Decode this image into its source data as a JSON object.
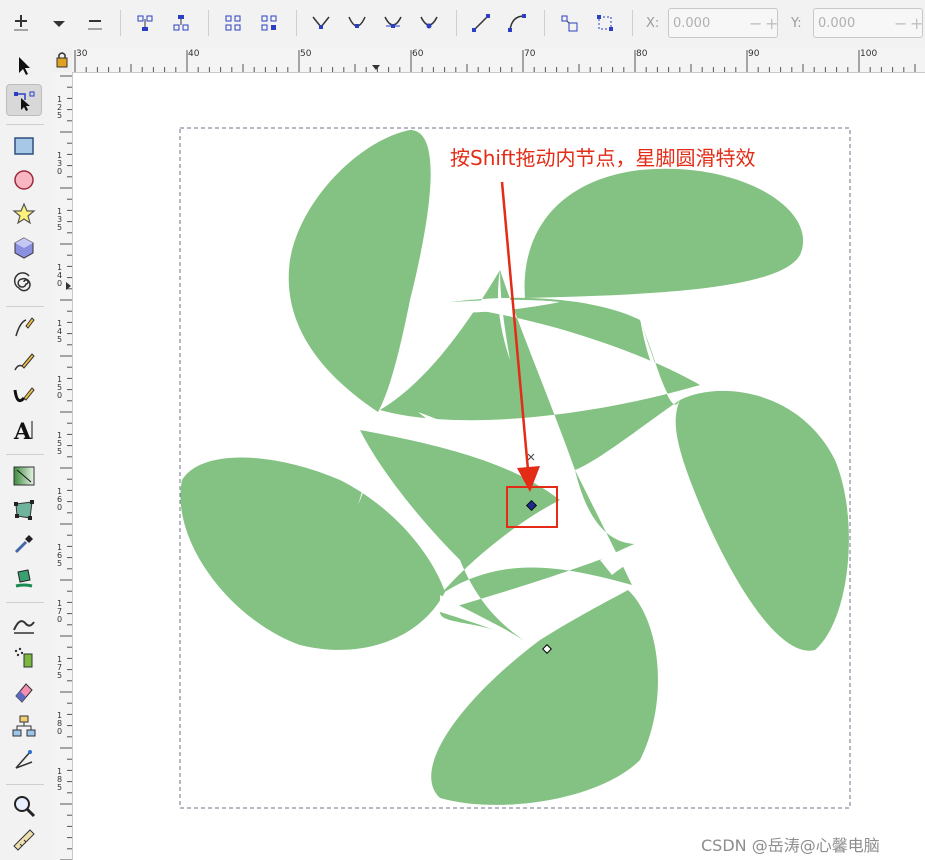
{
  "toolbar": {
    "x_label": "X:",
    "x_value": "0.000",
    "y_label": "Y:",
    "y_value": "0.000",
    "minus": "−",
    "plus": "+"
  },
  "ruler": {
    "h_labels": [
      "30",
      "40",
      "50",
      "60",
      "70",
      "80",
      "90",
      "100"
    ],
    "v_labels": [
      "1 2 5",
      "1 3 0",
      "1 3 5",
      "1 4 0",
      "1 4 5",
      "1 5 0",
      "1 5 5",
      "1 6 0",
      "1 6 5",
      "1 7 0",
      "1 7 5",
      "1 8 0",
      "1 8 5"
    ]
  },
  "tools": [
    "selector-tool",
    "node-tool",
    "rectangle-tool",
    "ellipse-tool",
    "star-tool",
    "3d-box-tool",
    "spiral-tool",
    "pen-tool",
    "pencil-tool",
    "calligraphy-tool",
    "text-tool",
    "gradient-tool",
    "mesh-tool",
    "dropper-tool",
    "paint-bucket-tool",
    "tweak-tool",
    "spray-tool",
    "eraser-tool",
    "connector-tool",
    "measure-tool",
    "zoom-tool",
    "ruler-tool"
  ],
  "canvas": {
    "shape_fill": "#83c282",
    "annotation": "按Shift拖动内节点，星脚圆滑特效",
    "annotation_color": "#e32b16"
  },
  "watermark": "CSDN @岳涛@心馨电脑"
}
